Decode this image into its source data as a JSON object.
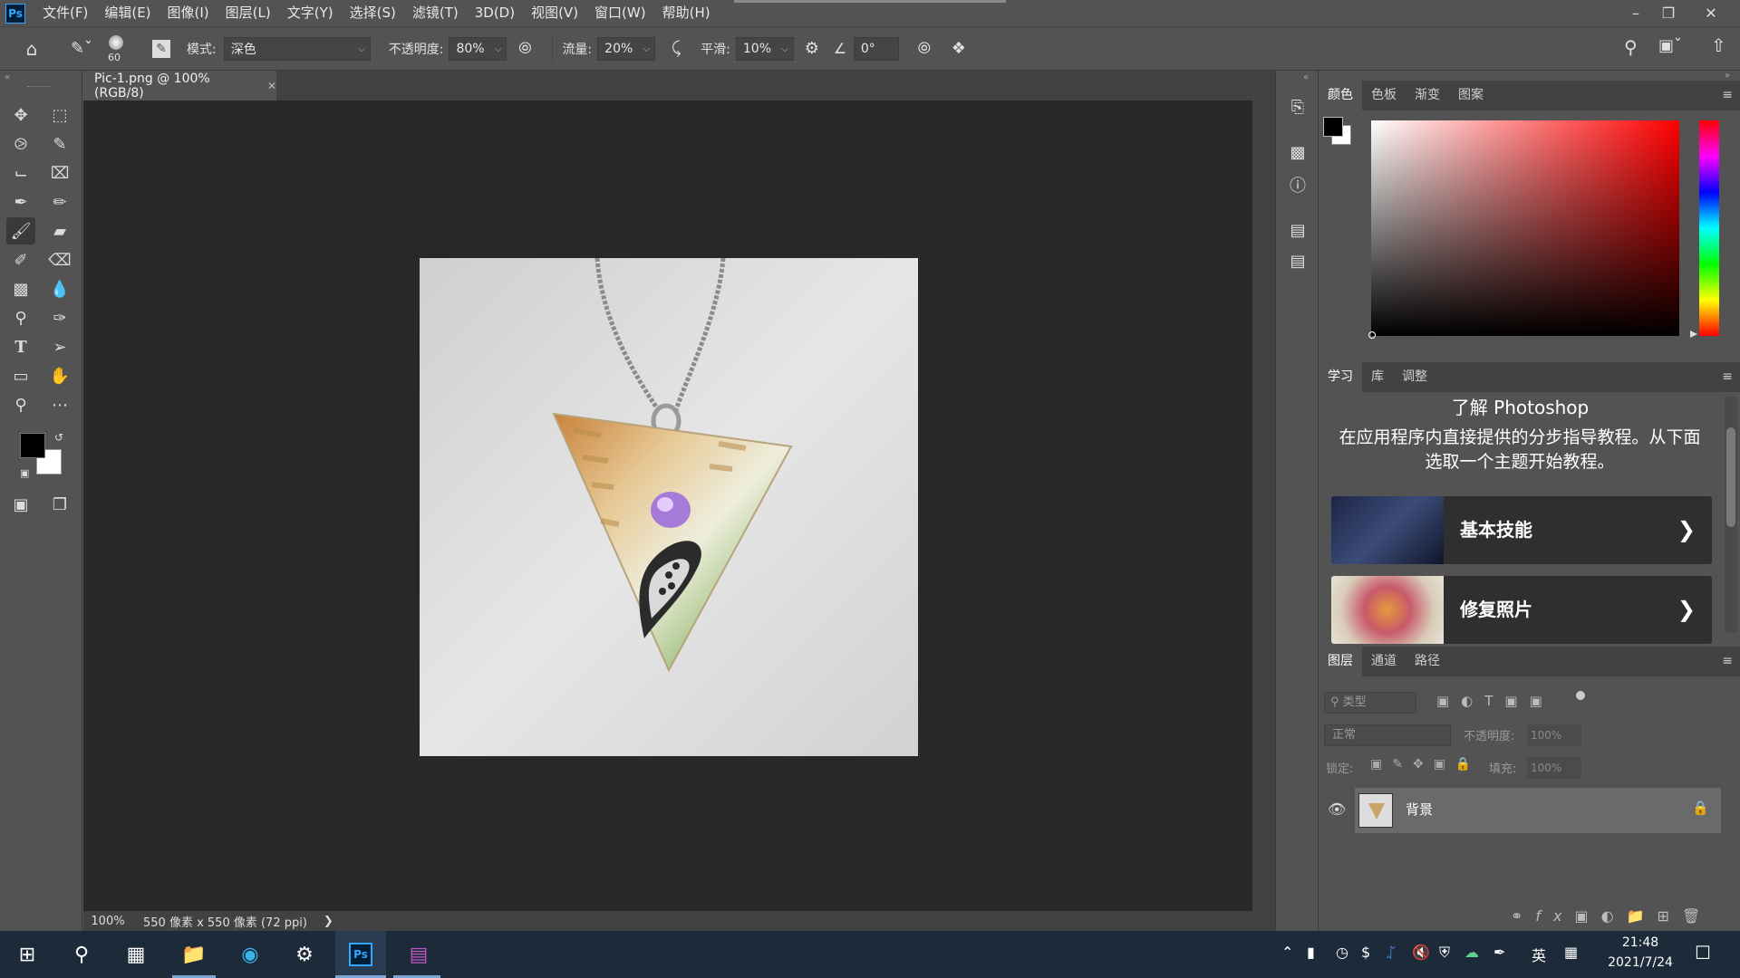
{
  "app": {
    "logo": "Ps"
  },
  "menu": [
    "文件(F)",
    "编辑(E)",
    "图像(I)",
    "图层(L)",
    "文字(Y)",
    "选择(S)",
    "滤镜(T)",
    "3D(D)",
    "视图(V)",
    "窗口(W)",
    "帮助(H)"
  ],
  "options": {
    "brush_size": "60",
    "mode_label": "模式:",
    "mode_value": "深色",
    "opacity_label": "不透明度:",
    "opacity_value": "80%",
    "flow_label": "流量:",
    "flow_value": "20%",
    "smooth_label": "平滑:",
    "smooth_value": "10%",
    "angle_value": "0°"
  },
  "document": {
    "tab_title": "Pic-1.png @ 100%(RGB/8)",
    "zoom": "100%",
    "info": "550 像素 x 550 像素 (72 ppi)"
  },
  "color_panel": {
    "tabs": [
      "颜色",
      "色板",
      "渐变",
      "图案"
    ]
  },
  "learn_panel": {
    "tabs": [
      "学习",
      "库",
      "调整"
    ],
    "title": "了解 Photoshop",
    "description": "在应用程序内直接提供的分步指导教程。从下面选取一个主题开始教程。",
    "cards": [
      "基本技能",
      "修复照片"
    ]
  },
  "layers_panel": {
    "tabs": [
      "图层",
      "通道",
      "路径"
    ],
    "filter_placeholder": "类型",
    "blend_mode": "正常",
    "opacity_label": "不透明度:",
    "opacity_value": "100%",
    "lock_label": "锁定:",
    "fill_label": "填充:",
    "fill_value": "100%",
    "layers": [
      {
        "name": "背景"
      }
    ]
  },
  "taskbar": {
    "ime": "英",
    "time": "21:48",
    "date": "2021/7/24"
  },
  "colors": {
    "foreground": "#000000",
    "background": "#ffffff",
    "accent": "#31a8ff"
  }
}
